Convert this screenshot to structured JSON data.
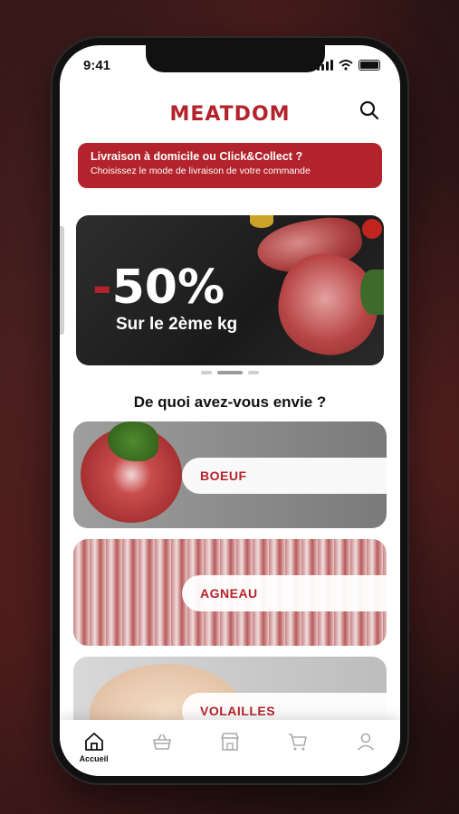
{
  "status_bar": {
    "time": "9:41"
  },
  "header": {
    "logo": "MEATDOM"
  },
  "delivery_banner": {
    "title": "Livraison à domicile ou Click&Collect ?",
    "subtitle": "Choisissez le mode de livraison de votre commande"
  },
  "promo": {
    "discount": "-50%",
    "tagline": "Sur le 2ème kg",
    "pager_count": 3,
    "pager_active": 2
  },
  "section": {
    "title": "De quoi avez-vous envie ?"
  },
  "categories": [
    {
      "label": "BOEUF"
    },
    {
      "label": "AGNEAU"
    },
    {
      "label": "VOLAILLES"
    }
  ],
  "tabbar": {
    "items": [
      {
        "icon": "home-icon",
        "label": "Accueil",
        "active": true
      },
      {
        "icon": "basket-icon",
        "label": ""
      },
      {
        "icon": "shop-icon",
        "label": ""
      },
      {
        "icon": "cart-icon",
        "label": ""
      },
      {
        "icon": "user-icon",
        "label": ""
      }
    ]
  },
  "colors": {
    "brand": "#b3232b",
    "text": "#111111"
  }
}
